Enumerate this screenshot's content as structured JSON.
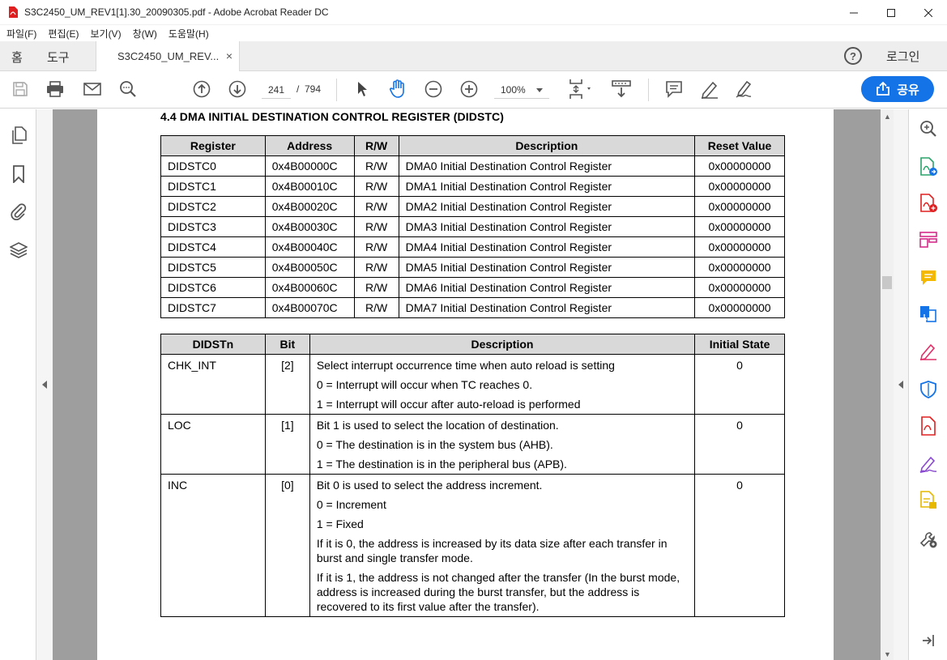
{
  "window": {
    "title": "S3C2450_UM_REV1[1].30_20090305.pdf - Adobe Acrobat Reader DC"
  },
  "menu": [
    "파일(F)",
    "편집(E)",
    "보기(V)",
    "창(W)",
    "도움말(H)"
  ],
  "tabs": {
    "home": "홈",
    "tools": "도구",
    "document": "S3C2450_UM_REV...",
    "close": "×",
    "help": "?",
    "login": "로그인"
  },
  "toolbar": {
    "page_current": "241",
    "page_separator": "/",
    "page_total": "794",
    "zoom": "100%",
    "share": "공유"
  },
  "colors": {
    "accent": "#1473e6",
    "header_fill": "#d9d9d9"
  },
  "document": {
    "section_title": "4.4 DMA INITIAL DESTINATION CONTROL REGISTER (DIDSTC)",
    "register_table": {
      "headers": [
        "Register",
        "Address",
        "R/W",
        "Description",
        "Reset Value"
      ],
      "rows": [
        [
          "DIDSTC0",
          "0x4B00000C",
          "R/W",
          "DMA0 Initial Destination Control Register",
          "0x00000000"
        ],
        [
          "DIDSTC1",
          "0x4B00010C",
          "R/W",
          "DMA1 Initial Destination Control Register",
          "0x00000000"
        ],
        [
          "DIDSTC2",
          "0x4B00020C",
          "R/W",
          "DMA2 Initial Destination Control Register",
          "0x00000000"
        ],
        [
          "DIDSTC3",
          "0x4B00030C",
          "R/W",
          "DMA3 Initial Destination Control Register",
          "0x00000000"
        ],
        [
          "DIDSTC4",
          "0x4B00040C",
          "R/W",
          "DMA4 Initial Destination Control Register",
          "0x00000000"
        ],
        [
          "DIDSTC5",
          "0x4B00050C",
          "R/W",
          "DMA5 Initial Destination Control Register",
          "0x00000000"
        ],
        [
          "DIDSTC6",
          "0x4B00060C",
          "R/W",
          "DMA6 Initial Destination Control Register",
          "0x00000000"
        ],
        [
          "DIDSTC7",
          "0x4B00070C",
          "R/W",
          "DMA7 Initial Destination Control Register",
          "0x00000000"
        ]
      ]
    },
    "bit_table": {
      "headers": [
        "DIDSTn",
        "Bit",
        "Description",
        "Initial State"
      ],
      "rows": [
        {
          "name": "CHK_INT",
          "bit": "[2]",
          "desc": [
            "Select interrupt occurrence time when auto reload is setting",
            "0 = Interrupt will occur when TC reaches 0.",
            "1 = Interrupt will occur after auto-reload is performed"
          ],
          "initial": "0"
        },
        {
          "name": "LOC",
          "bit": "[1]",
          "desc": [
            "Bit 1 is used to select the location of destination.",
            "0 = The destination is in the system bus (AHB).",
            "1 = The destination is in the peripheral bus (APB)."
          ],
          "initial": "0"
        },
        {
          "name": "INC",
          "bit": "[0]",
          "desc": [
            "Bit 0 is used to select the address increment.",
            "0 = Increment",
            "1 = Fixed",
            "If it is 0, the address is increased by its data size after each transfer in burst and single transfer mode.",
            "If it is 1, the address is not changed after the transfer (In the burst mode, address is increased during the burst transfer, but the address is recovered to its first value after the transfer)."
          ],
          "initial": "0"
        }
      ]
    }
  }
}
